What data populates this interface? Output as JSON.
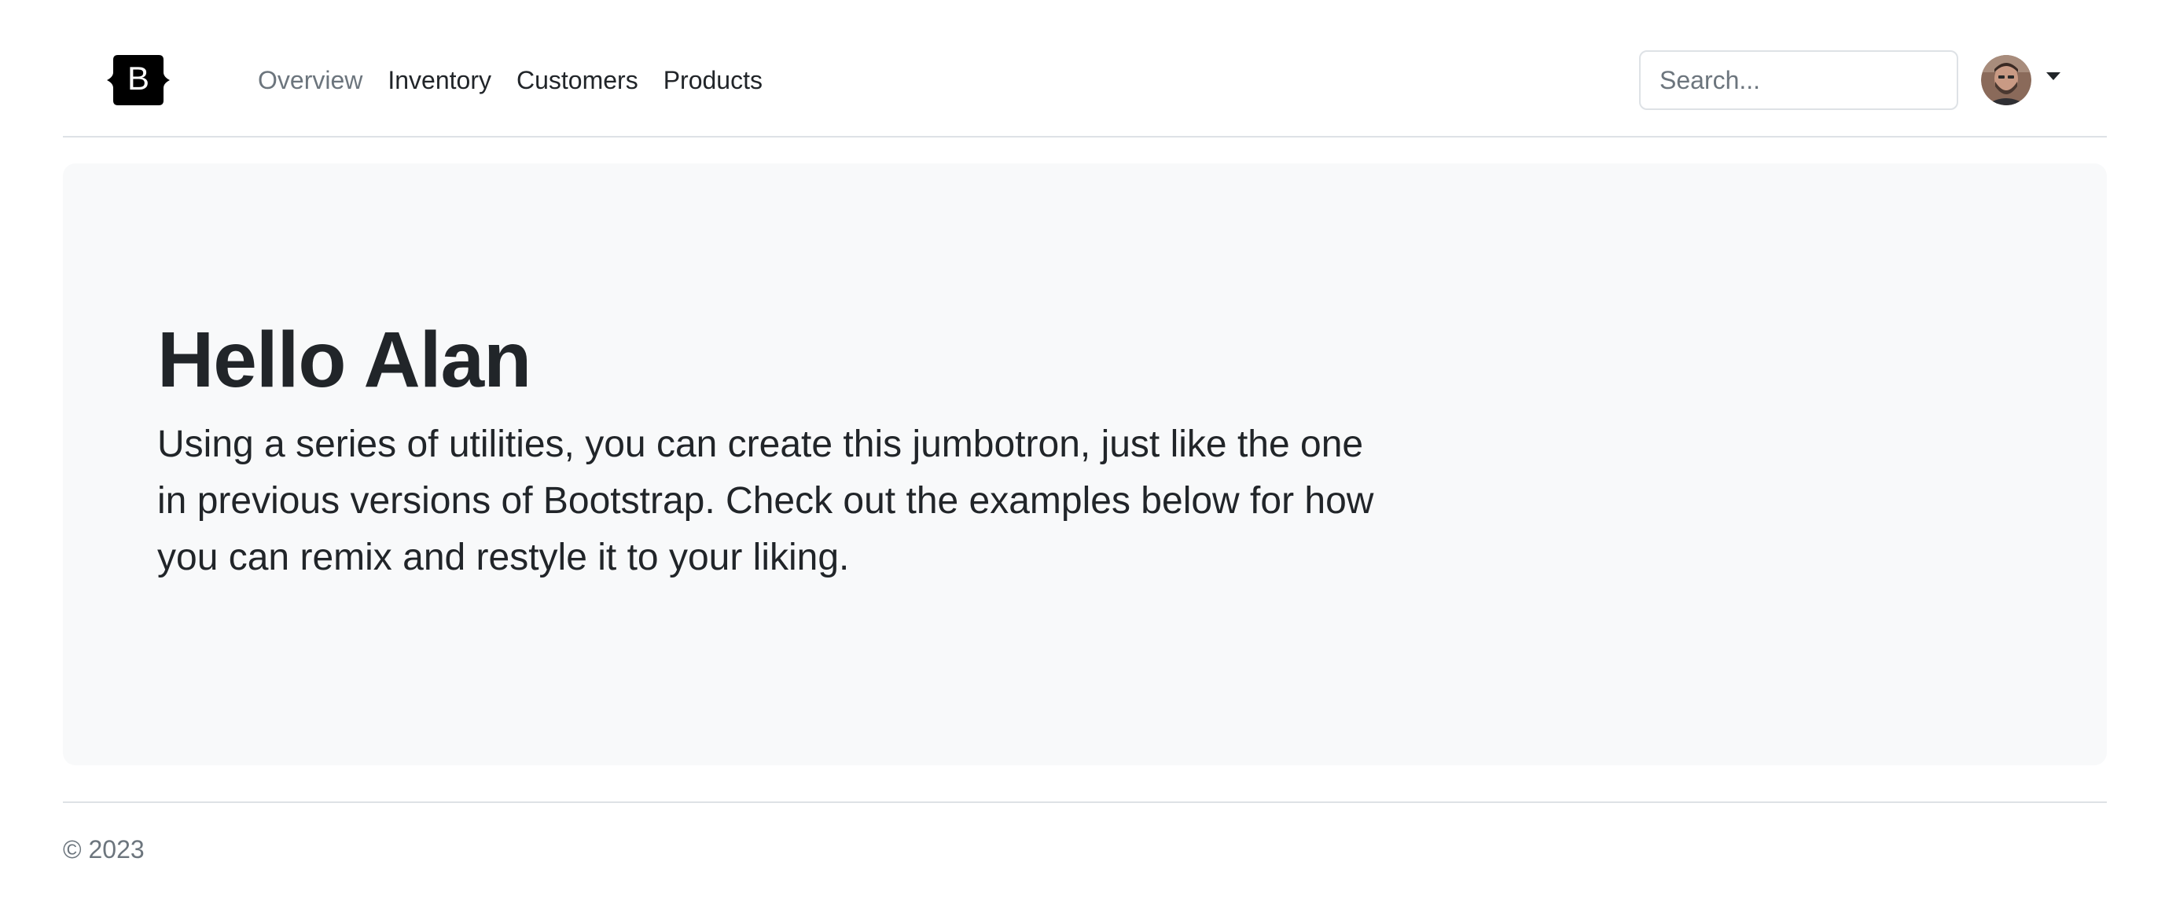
{
  "header": {
    "brand_icon": "bootstrap-logo-icon",
    "nav": [
      {
        "label": "Overview",
        "active": false
      },
      {
        "label": "Inventory",
        "active": false
      },
      {
        "label": "Customers",
        "active": false
      },
      {
        "label": "Products",
        "active": false
      }
    ],
    "search": {
      "value": "",
      "placeholder": "Search..."
    },
    "user_menu": {
      "avatar_icon": "user-avatar",
      "caret_icon": "caret-down-icon"
    }
  },
  "jumbotron": {
    "title": "Hello Alan",
    "text": "Using a series of utilities, you can create this jumbotron, just like the one in previous versions of Bootstrap. Check out the examples below for how you can remix and restyle it to your liking."
  },
  "footer": {
    "copyright": "© 2023"
  },
  "colors": {
    "text": "#212529",
    "muted": "#6c757d",
    "border": "#dee2e6",
    "jumbotron_bg": "#f8f9fa",
    "brand": "#000000"
  }
}
